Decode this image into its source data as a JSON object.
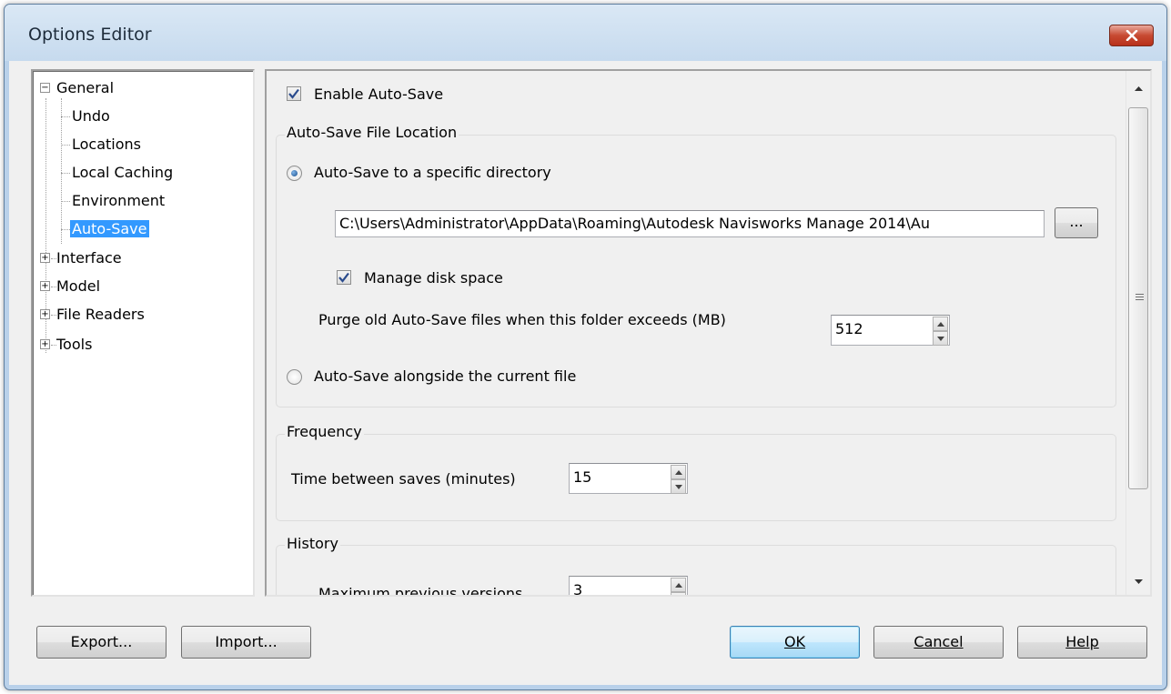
{
  "window": {
    "title": "Options Editor"
  },
  "tree": {
    "general": "General",
    "children": [
      "Undo",
      "Locations",
      "Local Caching",
      "Environment",
      "Auto-Save"
    ],
    "others": [
      "Interface",
      "Model",
      "File Readers",
      "Tools"
    ]
  },
  "autosave": {
    "enable_label": "Enable Auto-Save",
    "enable_checked": true,
    "location_group": "Auto-Save File Location",
    "specific_dir_label": "Auto-Save to a specific directory",
    "path_value": "C:\\Users\\Administrator\\AppData\\Roaming\\Autodesk Navisworks Manage 2014\\Au",
    "browse_label": "...",
    "manage_disk_label": "Manage disk space",
    "manage_disk_checked": true,
    "purge_label": "Purge old Auto-Save files when this folder exceeds (MB)",
    "purge_value": "512",
    "alongside_label": "Auto-Save alongside the current file",
    "selected_location": "specific"
  },
  "frequency": {
    "group": "Frequency",
    "time_label": "Time between saves (minutes)",
    "time_value": "15"
  },
  "history": {
    "group": "History",
    "max_label": "Maximum previous versions",
    "max_value": "3"
  },
  "buttons": {
    "export": "Export...",
    "import": "Import...",
    "ok": "OK",
    "cancel": "Cancel",
    "help": "Help"
  }
}
